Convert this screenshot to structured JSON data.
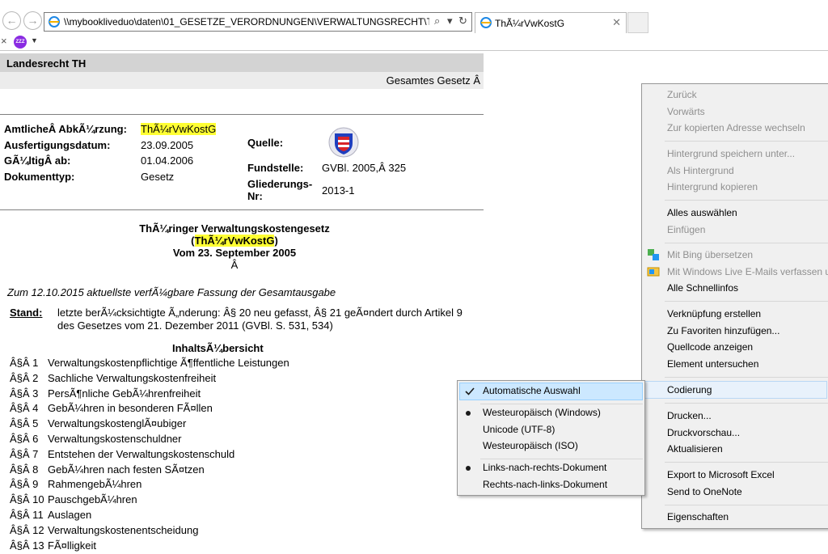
{
  "browser": {
    "address": "\\\\mybookliveduo\\daten\\01_GESETZE_VERORDNUNGEN\\VERWALTUNGSRECHT\\ThürVwKos",
    "tab_title": "ThÃ¼rVwKostG",
    "addr_search": "⌕",
    "addr_dropdown": "▾",
    "addr_refresh": "↻",
    "tab_close": "✕",
    "back_glyph": "←",
    "forward_glyph": "→",
    "close_glyph": "×",
    "tool_glyph": "ZZZ",
    "tool_arrow": "▼"
  },
  "document": {
    "header_title": "Landesrecht TH",
    "header_sub": "Gesamtes Gesetz Â",
    "meta": [
      {
        "label": "AmtlicheÂ AbkÃ¼rzung:",
        "value": "ThÃ¼rVwKostG"
      },
      {
        "label": "Ausfertigungsdatum:",
        "value": "23.09.2005"
      },
      {
        "label": "GÃ¼ltigÂ ab:",
        "value": "01.04.2006"
      },
      {
        "label": "Dokumenttyp:",
        "value": "Gesetz"
      }
    ],
    "meta_right": [
      {
        "label": "Quelle:",
        "value": ""
      },
      {
        "label": "Fundstelle:",
        "value": "GVBl. 2005,Â 325"
      },
      {
        "label": "Gliederungs-",
        "label2": "Nr:",
        "value": "2013-1"
      }
    ],
    "title_line1": "ThÃ¼ringer Verwaltungskostengesetz",
    "title_open": "(",
    "title_abbr": "ThÃ¼rVwKostG",
    "title_close": ")",
    "title_date": "Vom 23. September 2005",
    "title_a": "Â",
    "current_version": "Zum 12.10.2015 aktuellste verfÃ¼gbare Fassung der Gesamtausgabe",
    "stand_label": "Stand:",
    "stand_text": "letzte berÃ¼cksichtigte Ã„nderung: Â§ 20 neu gefasst, Â§ 21 geÃ¤ndert durch Artikel 9 des Gesetzes vom 21. Dezember 2011 (GVBl. S. 531, 534)",
    "toc_title": "InhaltsÃ¼bersicht",
    "toc": [
      {
        "num": "Â§Â 1",
        "text": "Verwaltungskostenpflichtige Ã¶ffentliche Leistungen"
      },
      {
        "num": "Â§Â 2",
        "text": "Sachliche Verwaltungskostenfreiheit"
      },
      {
        "num": "Â§Â 3",
        "text": "PersÃ¶nliche GebÃ¼hrenfreiheit"
      },
      {
        "num": "Â§Â 4",
        "text": "GebÃ¼hren in besonderen FÃ¤llen"
      },
      {
        "num": "Â§Â 5",
        "text": "VerwaltungskostenglÃ¤ubiger"
      },
      {
        "num": "Â§Â 6",
        "text": "Verwaltungskostenschuldner"
      },
      {
        "num": "Â§Â 7",
        "text": "Entstehen der Verwaltungskostenschuld"
      },
      {
        "num": "Â§Â 8",
        "text": "GebÃ¼hren nach festen SÃ¤tzen"
      },
      {
        "num": "Â§Â 9",
        "text": "RahmengebÃ¼hren"
      },
      {
        "num": "Â§Â 10",
        "text": "PauschgebÃ¼hren"
      },
      {
        "num": "Â§Â 11",
        "text": "Auslagen"
      },
      {
        "num": "Â§Â 12",
        "text": "Verwaltungskostenentscheidung"
      },
      {
        "num": "Â§Â 13",
        "text": "FÃ¤lligkeit"
      }
    ]
  },
  "context_menu": {
    "items": [
      {
        "label": "Zurück",
        "enabled": false
      },
      {
        "label": "Vorwärts",
        "enabled": false
      },
      {
        "label": "Zur kopierten Adresse wechseln",
        "enabled": false
      },
      {
        "label": "Hintergrund speichern unter...",
        "enabled": false
      },
      {
        "label": "Als Hintergrund",
        "enabled": false
      },
      {
        "label": "Hintergrund kopieren",
        "enabled": false
      },
      {
        "label": "Alles auswählen",
        "enabled": true
      },
      {
        "label": "Einfügen",
        "enabled": false
      },
      {
        "label": "Mit Bing übersetzen",
        "enabled": false
      },
      {
        "label": "Mit Windows Live E-Mails verfassen und",
        "enabled": false
      },
      {
        "label": "Alle Schnellinfos",
        "enabled": true
      },
      {
        "label": "Verknüpfung erstellen",
        "enabled": true
      },
      {
        "label": "Zu Favoriten hinzufügen...",
        "enabled": true
      },
      {
        "label": "Quellcode anzeigen",
        "enabled": true
      },
      {
        "label": "Element untersuchen",
        "enabled": true
      },
      {
        "label": "Codierung",
        "enabled": true,
        "highlighted": true
      },
      {
        "label": "Drucken...",
        "enabled": true
      },
      {
        "label": "Druckvorschau...",
        "enabled": true
      },
      {
        "label": "Aktualisieren",
        "enabled": true
      },
      {
        "label": "Export to Microsoft Excel",
        "enabled": true
      },
      {
        "label": "Send to OneNote",
        "enabled": true
      },
      {
        "label": "Eigenschaften",
        "enabled": true
      }
    ]
  },
  "encoding_menu": {
    "items": [
      {
        "label": "Automatische Auswahl",
        "checked": true
      },
      {
        "label": "Westeuropäisch (Windows)",
        "selected": true
      },
      {
        "label": "Unicode (UTF-8)",
        "selected": false
      },
      {
        "label": "Westeuropäisch (ISO)",
        "selected": false
      },
      {
        "label": "Links-nach-rechts-Dokument",
        "selected": true
      },
      {
        "label": "Rechts-nach-links-Dokument",
        "selected": false
      }
    ]
  },
  "colors": {
    "highlight": "#ffff33",
    "header_bar": "#d3d3d3",
    "menu_bg": "#f0f0f0",
    "menu_hover": "#cce8ff"
  }
}
